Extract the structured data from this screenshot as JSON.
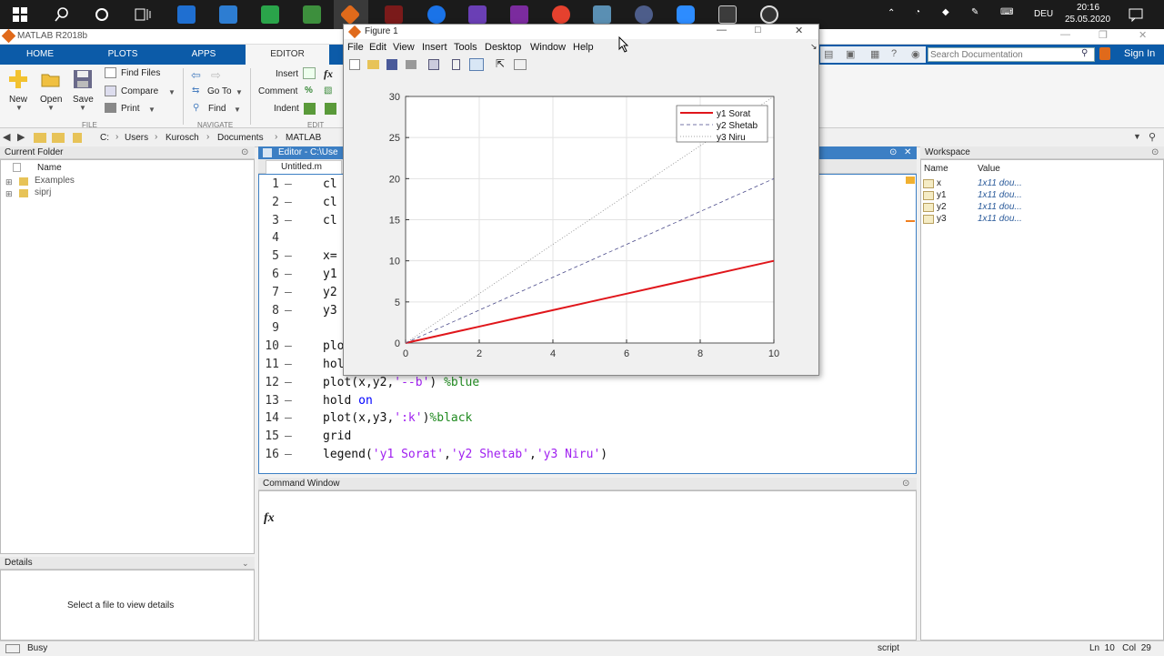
{
  "taskbar": {
    "time": "20:16",
    "date": "25.05.2020",
    "language": "DEU"
  },
  "window": {
    "title": "MATLAB R2018b"
  },
  "ribbon": {
    "tabs": [
      "HOME",
      "PLOTS",
      "APPS",
      "EDITOR"
    ],
    "new_label": "New",
    "open_label": "Open",
    "save_label": "Save",
    "find_files_label": "Find Files",
    "compare_label": "Compare",
    "print_label": "Print",
    "goto_label": "Go To",
    "find_label": "Find",
    "insert_label": "Insert",
    "comment_label": "Comment",
    "indent_label": "Indent",
    "fx_label": "fx",
    "group_file": "FILE",
    "group_navigate": "NAVIGATE",
    "group_edit": "EDIT",
    "search_placeholder": "Search Documentation",
    "signin_label": "Sign In"
  },
  "address": {
    "segments": [
      "C:",
      "Users",
      "Kurosch",
      "Documents",
      "MATLAB"
    ]
  },
  "current_folder": {
    "title": "Current Folder",
    "column": "Name",
    "items": [
      "Examples",
      "siprj"
    ]
  },
  "details": {
    "title": "Details",
    "message": "Select a file to view details"
  },
  "editor": {
    "title": "Editor - C:\\Use",
    "tab": "Untitled.m",
    "lines": [
      {
        "n": "1",
        "dash": "—",
        "code": "cl"
      },
      {
        "n": "2",
        "dash": "—",
        "code": "cl"
      },
      {
        "n": "3",
        "dash": "—",
        "code": "cl"
      },
      {
        "n": "4",
        "dash": "",
        "code": ""
      },
      {
        "n": "5",
        "dash": "—",
        "code": "x="
      },
      {
        "n": "6",
        "dash": "—",
        "code": "y1"
      },
      {
        "n": "7",
        "dash": "—",
        "code": "y2"
      },
      {
        "n": "8",
        "dash": "—",
        "code": "y3"
      },
      {
        "n": "9",
        "dash": "",
        "code": ""
      },
      {
        "n": "10",
        "dash": "—",
        "code": "plo"
      },
      {
        "n": "11",
        "dash": "—",
        "code": "hol"
      },
      {
        "n": "12",
        "dash": "—",
        "code_parts": [
          "plot(x,y2,",
          "'--b'",
          ") ",
          "%blue"
        ]
      },
      {
        "n": "13",
        "dash": "—",
        "code_parts": [
          "hold ",
          "on"
        ]
      },
      {
        "n": "14",
        "dash": "—",
        "code_parts": [
          "plot(x,y3,",
          "':k'",
          ")",
          "%black"
        ]
      },
      {
        "n": "15",
        "dash": "—",
        "code": "grid"
      },
      {
        "n": "16",
        "dash": "—",
        "code_parts": [
          "legend(",
          "'y1 Sorat'",
          ",",
          "'y2 Shetab'",
          ",",
          "'y3 Niru'",
          ")"
        ]
      }
    ]
  },
  "command_window": {
    "title": "Command Window",
    "prompt": "fx"
  },
  "workspace": {
    "title": "Workspace",
    "col_name": "Name",
    "col_value": "Value",
    "vars": [
      {
        "name": "x",
        "value": "1x11 dou..."
      },
      {
        "name": "y1",
        "value": "1x11 dou..."
      },
      {
        "name": "y2",
        "value": "1x11 dou..."
      },
      {
        "name": "y3",
        "value": "1x11 dou..."
      }
    ]
  },
  "figure": {
    "title": "Figure 1",
    "menu": [
      "File",
      "Edit",
      "View",
      "Insert",
      "Tools",
      "Desktop",
      "Window",
      "Help"
    ]
  },
  "chart_data": {
    "type": "line",
    "x": [
      0,
      1,
      2,
      3,
      4,
      5,
      6,
      7,
      8,
      9,
      10
    ],
    "series": [
      {
        "name": "y1 Sorat",
        "values": [
          0,
          1,
          2,
          3,
          4,
          5,
          6,
          7,
          8,
          9,
          10
        ],
        "color": "#e0161b",
        "style": "solid"
      },
      {
        "name": "y2 Shetab",
        "values": [
          0,
          2,
          4,
          6,
          8,
          10,
          12,
          14,
          16,
          18,
          20
        ],
        "color": "#4a4a8a",
        "style": "dashed"
      },
      {
        "name": "y3 Niru",
        "values": [
          0,
          3,
          6,
          9,
          12,
          15,
          18,
          21,
          24,
          27,
          30
        ],
        "color": "#888888",
        "style": "dotted"
      }
    ],
    "xlim": [
      0,
      10
    ],
    "ylim": [
      0,
      30
    ],
    "xticks": [
      0,
      2,
      4,
      6,
      8,
      10
    ],
    "yticks": [
      0,
      5,
      10,
      15,
      20,
      25,
      30
    ],
    "grid": true,
    "legend_position": "top-right"
  },
  "status": {
    "left": "Busy",
    "mode": "script",
    "position": "Ln  10   Col  29"
  }
}
